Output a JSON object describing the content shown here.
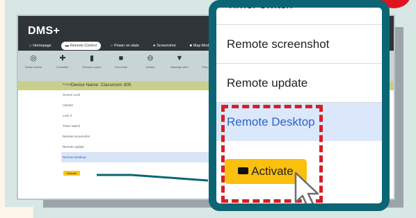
{
  "app": {
    "brand": "DMS+",
    "nav": [
      "Homepage",
      "Remote Control",
      "Power on state",
      "Screenshot",
      "Map Mode"
    ],
    "toolbar": [
      "Delete device",
      "Controller",
      "Remote control",
      "Live mode",
      "Unbind",
      "Message alert",
      "Play mode"
    ],
    "device_label": "Device Name: Classroom 305",
    "menu": [
      "Power",
      "Screen Lock",
      "Volume",
      "Lock it",
      "Timer switch",
      "Remote screenshot",
      "Remote update",
      "Remote Desktop"
    ],
    "activate_label": "Activate"
  },
  "zoom": {
    "rows": [
      "Timer switch",
      "Remote screenshot",
      "Remote update",
      "Remote Desktop"
    ],
    "activate_label": "Activate"
  },
  "colors": {
    "accent_teal": "#0b6574",
    "activate_yellow": "#fbbf0f",
    "highlight_blue": "#dbe7fa",
    "link_blue": "#2d63c8",
    "dash_red": "#d71e27"
  },
  "icons": [
    "tv-icon",
    "plus-icon",
    "phone-icon",
    "square-icon",
    "link-icon",
    "chat-icon",
    "play-icon",
    "monitor-icon",
    "cursor-icon"
  ]
}
